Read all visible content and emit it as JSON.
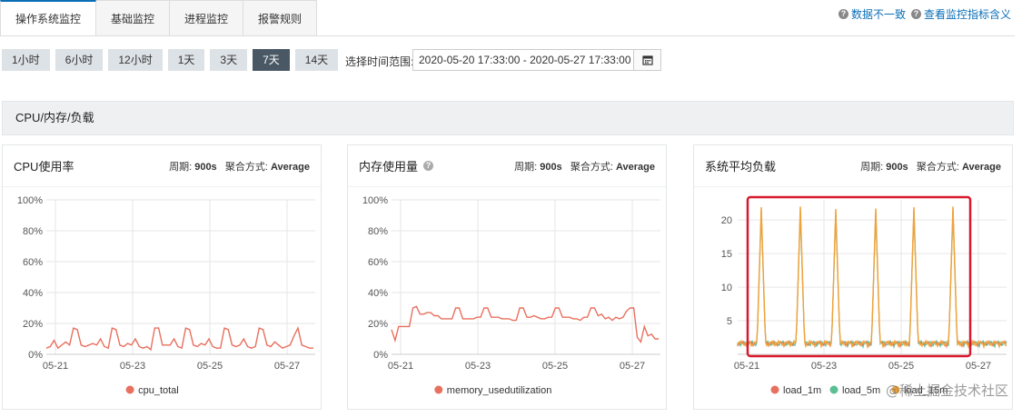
{
  "tabs": [
    "操作系统监控",
    "基础监控",
    "进程监控",
    "报警规则"
  ],
  "help": [
    "数据不一致",
    "查看监控指标含义"
  ],
  "time_buttons": [
    "1小时",
    "6小时",
    "12小时",
    "1天",
    "3天",
    "7天",
    "14天"
  ],
  "active_time": "7天",
  "range_label": "选择时间范围:",
  "range_value": "2020-05-20 17:33:00 - 2020-05-27 17:33:00",
  "section_title": "CPU/内存/负载",
  "period_label": "周期:",
  "period_value": "900s",
  "agg_label": "聚合方式:",
  "agg_value": "Average",
  "panels": [
    {
      "title": "CPU使用率",
      "has_help": false
    },
    {
      "title": "内存使用量",
      "has_help": true
    },
    {
      "title": "系统平均负载",
      "has_help": false
    }
  ],
  "watermark": "@稀土掘金技术社区",
  "colors": {
    "accent": "#0a6eb7",
    "series_red": "#e8705f",
    "series_green": "#5bbf94",
    "series_orange": "#f0a33a",
    "highlight_box": "#d9192c"
  },
  "chart_data": [
    {
      "type": "line",
      "x": [
        "05-21",
        "05-23",
        "05-25",
        "05-27"
      ],
      "y_ticks": [
        "0%",
        "20%",
        "40%",
        "60%",
        "80%",
        "100%"
      ],
      "ylim": [
        0,
        100
      ],
      "series": [
        {
          "name": "cpu_total",
          "color": "#e8705f",
          "values": [
            4,
            5,
            9,
            4,
            6,
            8,
            6,
            17,
            16,
            6,
            5,
            6,
            7,
            6,
            10,
            5,
            4,
            17,
            16,
            6,
            5,
            7,
            6,
            10,
            5,
            4,
            5,
            3,
            17,
            17,
            6,
            6,
            6,
            10,
            5,
            4,
            17,
            16,
            6,
            5,
            7,
            6,
            10,
            5,
            4,
            4,
            17,
            16,
            6,
            5,
            6,
            10,
            5,
            4,
            5,
            17,
            16,
            6,
            5,
            8,
            6,
            4,
            5,
            6,
            12,
            17,
            6,
            5,
            4,
            4
          ]
        }
      ]
    },
    {
      "type": "line",
      "x": [
        "05-21",
        "05-23",
        "05-25",
        "05-27"
      ],
      "y_ticks": [
        "0%",
        "20%",
        "40%",
        "60%",
        "80%",
        "100%"
      ],
      "ylim": [
        0,
        100
      ],
      "series": [
        {
          "name": "memory_usedutilization",
          "color": "#e8705f",
          "values": [
            16,
            9,
            18,
            18,
            18,
            18,
            30,
            31,
            26,
            26,
            27,
            27,
            25,
            25,
            23,
            23,
            23,
            23,
            30,
            30,
            23,
            23,
            23,
            23,
            24,
            24,
            30,
            30,
            24,
            24,
            24,
            23,
            23,
            23,
            22,
            22,
            30,
            30,
            24,
            24,
            25,
            24,
            23,
            23,
            24,
            24,
            30,
            30,
            24,
            24,
            24,
            23,
            23,
            22,
            24,
            24,
            30,
            30,
            25,
            26,
            23,
            24,
            22,
            24,
            23,
            24,
            28,
            30,
            30,
            11,
            8,
            18,
            12,
            13,
            10,
            10
          ]
        }
      ]
    },
    {
      "type": "line",
      "x": [
        "05-21",
        "05-23",
        "05-25",
        "05-27"
      ],
      "y_ticks": [
        "5",
        "10",
        "15",
        "20"
      ],
      "ylim": [
        0,
        23
      ],
      "series": [
        {
          "name": "load_1m",
          "color": "#e8705f"
        },
        {
          "name": "load_5m",
          "color": "#5bbf94"
        },
        {
          "name": "load_15m",
          "color": "#f0a33a"
        }
      ],
      "peaks": [
        21.9,
        22.0,
        21.6,
        21.7,
        21.9,
        22.0
      ],
      "baseline": 1.0
    }
  ]
}
